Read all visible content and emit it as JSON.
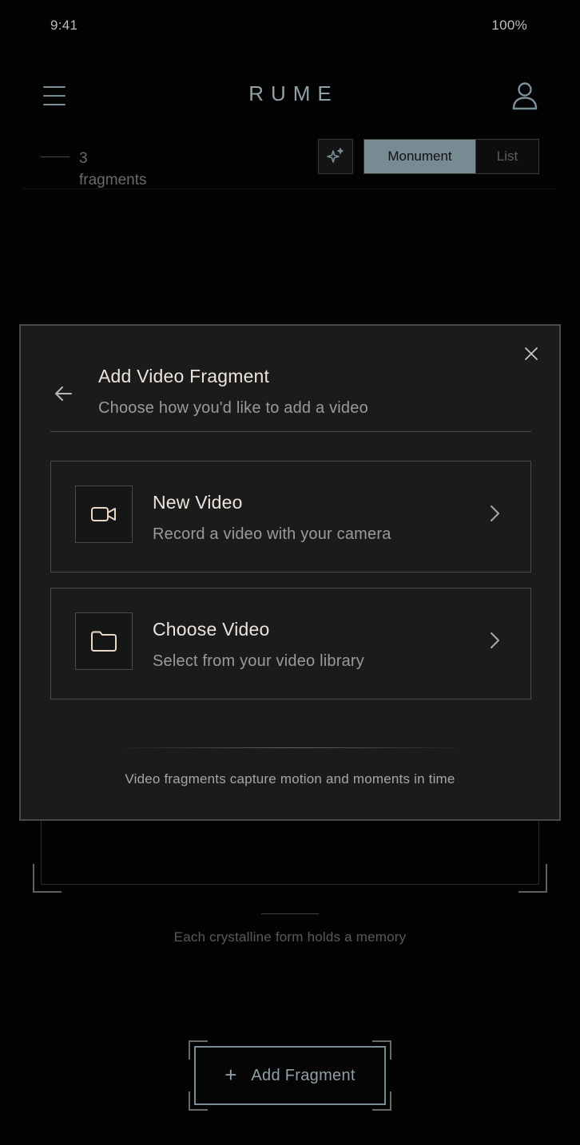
{
  "status_bar": {
    "time": "9:41",
    "battery": "100%"
  },
  "header": {
    "brand": "RUME",
    "menu_icon": "hamburger-menu-icon",
    "profile_icon": "user-profile-icon"
  },
  "toolbar": {
    "fragment_count": "3",
    "fragment_label": "fragments",
    "sparkle_icon": "sparkle-icon",
    "view_toggle": {
      "active": "Monument",
      "inactive": "List"
    }
  },
  "background": {
    "caption": "Each crystalline form holds a memory"
  },
  "add_fragment": {
    "plus": "+",
    "label": "Add Fragment"
  },
  "modal": {
    "title": "Add Video Fragment",
    "subtitle": "Choose how you'd like to add a video",
    "options": [
      {
        "icon": "video-camera-icon",
        "title": "New Video",
        "description": "Record a video with your camera"
      },
      {
        "icon": "folder-icon",
        "title": "Choose Video",
        "description": "Select from your video library"
      }
    ],
    "footer": "Video fragments capture motion and moments in time"
  },
  "colors": {
    "background": "#030303",
    "modal_bg": "#1b1b1b",
    "accent": "#788a92",
    "icon_accent": "#e8d8c8",
    "text_primary": "#ebe4dc"
  }
}
